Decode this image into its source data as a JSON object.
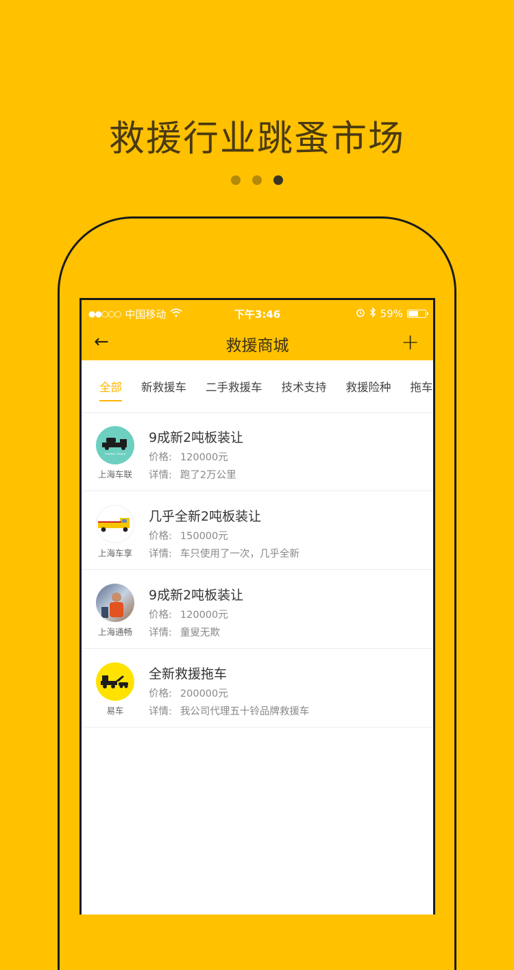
{
  "headline": "救援行业跳蚤市场",
  "pager": {
    "count": 3,
    "active_index": 2
  },
  "status_bar": {
    "signal": "●●○○○",
    "carrier": "中国移动",
    "time": "下午3:46",
    "battery": "59%",
    "battery_level": 0.59
  },
  "navbar": {
    "title": "救援商城",
    "back_icon": "arrow-left-icon",
    "add_icon": "plus-icon"
  },
  "tabs": [
    {
      "label": "全部",
      "active": true
    },
    {
      "label": "新救援车"
    },
    {
      "label": "二手救援车"
    },
    {
      "label": "技术支持"
    },
    {
      "label": "救援险种"
    },
    {
      "label": "拖车"
    }
  ],
  "items": [
    {
      "shop": "上海车联",
      "title": "9成新2吨板装让",
      "price_label": "价格:",
      "price": "120000元",
      "detail_label": "详情:",
      "detail": "跑了2万公里",
      "avatar_label": "TOWING TRUCK"
    },
    {
      "shop": "上海车享",
      "title": "几乎全新2吨板装让",
      "price_label": "价格:",
      "price": "150000元",
      "detail_label": "详情:",
      "detail": "车只使用了一次，几乎全新"
    },
    {
      "shop": "上海通畅",
      "title": "9成新2吨板装让",
      "price_label": "价格:",
      "price": "120000元",
      "detail_label": "详情:",
      "detail": "童叟无欺"
    },
    {
      "shop": "易车",
      "title": "全新救援拖车",
      "price_label": "价格:",
      "price": "200000元",
      "detail_label": "详情:",
      "detail": "我公司代理五十铃品牌救援车"
    }
  ],
  "colors": {
    "brand_yellow": "#FFC100",
    "tab_active": "#FFB400"
  }
}
